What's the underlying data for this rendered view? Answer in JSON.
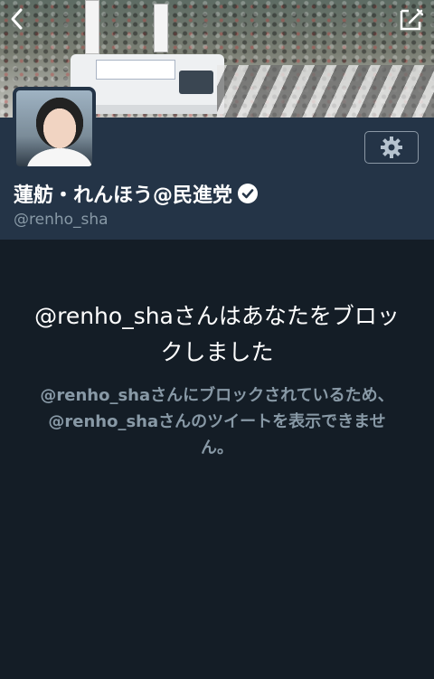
{
  "header": {
    "back_icon": "chevron-left-icon",
    "compose_icon": "compose-icon"
  },
  "profile": {
    "display_name": "蓮舫・れんほう@民進党",
    "verified": true,
    "handle": "@renho_sha",
    "settings_icon": "gear-icon"
  },
  "blocked": {
    "title": "@renho_shaさんはあなたをブロックしました",
    "description": "@renho_shaさんにブロックされているため、@renho_shaさんのツイートを表示できません。"
  },
  "colors": {
    "background": "#141d26",
    "header_panel": "#243447",
    "secondary_text": "#8899a6",
    "primary_text": "#ffffff"
  }
}
